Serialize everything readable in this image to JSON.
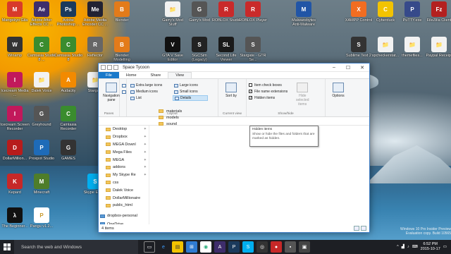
{
  "desktop_icons": [
    {
      "label": "Mangekyo Gila",
      "color": "#d83a2a",
      "glyph": "M"
    },
    {
      "label": "Adobe After Effects CC ...",
      "color": "#3e2d6b",
      "glyph": "Ae"
    },
    {
      "label": "Adobe Photoshop ...",
      "color": "#1b3a5c",
      "glyph": "Ps"
    },
    {
      "label": "Adobe Media Encoder CC ...",
      "color": "#222233",
      "glyph": "Me"
    },
    {
      "label": "Blender",
      "color": "#e37b1a",
      "glyph": "B"
    },
    {
      "label": "Garry's Mod Stuff",
      "color": "#f2f2f2",
      "glyph": "📁"
    },
    {
      "label": "Garry's Mod",
      "color": "#555",
      "glyph": "G"
    },
    {
      "label": "ROBLOX Studio",
      "color": "#c92a2a",
      "glyph": "R"
    },
    {
      "label": "ROBLOX Player",
      "color": "#c92a2a",
      "glyph": "R"
    },
    {
      "label": "Malwarebytes Anti-Malware",
      "color": "#2155a6",
      "glyph": "M"
    },
    {
      "label": "XAMPP Control",
      "color": "#f26d21",
      "glyph": "X"
    },
    {
      "label": "Cyberduck",
      "color": "#f2c300",
      "glyph": "C"
    },
    {
      "label": "PuTTY.exe",
      "color": "#364a8a",
      "glyph": "P"
    },
    {
      "label": "FileZilla Client",
      "color": "#b3201f",
      "glyph": "Fz"
    },
    {
      "label": "Winamp",
      "color": "#333",
      "glyph": "W"
    },
    {
      "label": "Camtasia Studio 8 ...",
      "color": "#3a8c2e",
      "glyph": "C"
    },
    {
      "label": "Camtasia Studio 8",
      "color": "#3a8c2e",
      "glyph": "C"
    },
    {
      "label": "Reflector",
      "color": "#666",
      "glyph": "R"
    },
    {
      "label": "Blender Modelling",
      "color": "#e37b1a",
      "glyph": "B"
    },
    {
      "label": "GTA V Save Editor",
      "color": "#111",
      "glyph": "V"
    },
    {
      "label": "SGCSim (Legacy)",
      "color": "#222",
      "glyph": "S"
    },
    {
      "label": "Second Life Viewer",
      "color": "#1a1a1a",
      "glyph": "SL"
    },
    {
      "label": "Stargate - GTR Se...",
      "color": "#555",
      "glyph": "S"
    },
    {
      "label": "Sublime Text 2",
      "color": "#333",
      "glyph": "S"
    },
    {
      "label": "spcheckerstat...",
      "color": "#f2f2f2",
      "glyph": "📁"
    },
    {
      "label": "themefiles...",
      "color": "#f2f2f2",
      "glyph": "📁"
    },
    {
      "label": "Paypal Receipt",
      "color": "#f2f2f2",
      "glyph": "📁"
    },
    {
      "label": "Icecream Media ...",
      "color": "#c2185b",
      "glyph": "I"
    },
    {
      "label": "Dalek Voice",
      "color": "#f2f2f2",
      "glyph": "📁"
    },
    {
      "label": "Audacity",
      "color": "#f28a00",
      "glyph": "A"
    },
    {
      "label": "Stargate",
      "color": "#f2f2f2",
      "glyph": "📁"
    },
    {
      "label": "Icecream Screen Recorder",
      "color": "#c2185b",
      "glyph": "I"
    },
    {
      "label": "Greyhound",
      "color": "#555",
      "glyph": "G"
    },
    {
      "label": "Camtasia Recorder",
      "color": "#3a8c2e",
      "glyph": "C"
    },
    {
      "label": "DollarMillion...",
      "color": "#b71c1c",
      "glyph": "D"
    },
    {
      "label": "Proxpot Studio",
      "color": "#1e6bb8",
      "glyph": "P"
    },
    {
      "label": "GAMES",
      "color": "#333",
      "glyph": "G"
    },
    {
      "label": "Kepard",
      "color": "#c62828",
      "glyph": "K"
    },
    {
      "label": "Minecraft",
      "color": "#4e7d2a",
      "glyph": "M"
    },
    {
      "label": "Skype Export",
      "color": "#00aff0",
      "glyph": "S"
    },
    {
      "label": "The Beginner...",
      "color": "#111",
      "glyph": "λ"
    },
    {
      "label": "Pangu v1.2...",
      "color": "#fff",
      "glyph": "P"
    }
  ],
  "window": {
    "title": "Space Tycoon",
    "tabs": [
      "File",
      "Home",
      "Share",
      "View"
    ],
    "ribbon": {
      "navigation_pane": "Navigation pane",
      "panes_label": "Panes",
      "layout_options": [
        "Extra large icons",
        "Large icons",
        "Medium icons",
        "Small icons",
        "List",
        "Details"
      ],
      "layout_label": "Layout",
      "sort_by": "Sort by",
      "current_view_label": "Current view",
      "checkboxes": [
        {
          "label": "Item check boxes",
          "checked": false
        },
        {
          "label": "File name extensions",
          "checked": true
        },
        {
          "label": "Hidden items",
          "checked": true
        }
      ],
      "hide_selected": "Hide selected items",
      "show_hide_label": "Show/hide",
      "options": "Options"
    },
    "tooltip": {
      "title": "Hidden items",
      "body": "Show or hide the files and folders that are marked as hidden."
    },
    "nav_items": [
      {
        "label": "Desktop",
        "pinned": true,
        "top": false
      },
      {
        "label": "Dropbox",
        "pinned": true,
        "top": false
      },
      {
        "label": "MEGA Downl",
        "pinned": true,
        "top": false
      },
      {
        "label": "Mega Files",
        "pinned": true,
        "top": false
      },
      {
        "label": "MEGA",
        "pinned": true,
        "top": false
      },
      {
        "label": "addons",
        "pinned": true,
        "top": false
      },
      {
        "label": "My Skype Re",
        "pinned": true,
        "top": false
      },
      {
        "label": "css",
        "pinned": false,
        "top": false
      },
      {
        "label": "Dalek Voice",
        "pinned": false,
        "top": false
      },
      {
        "label": "DollarMillionaire",
        "pinned": false,
        "top": false
      },
      {
        "label": "public_html",
        "pinned": false,
        "top": false
      },
      {
        "label": "dropbox-personal",
        "pinned": false,
        "top": true
      },
      {
        "label": "OneDrive",
        "pinned": false,
        "top": true
      },
      {
        "label": "This PC",
        "pinned": false,
        "top": true
      }
    ],
    "files": [
      "materials",
      "models",
      "sound"
    ],
    "status": "4 items"
  },
  "taskbar": {
    "search_placeholder": "Search the web and Windows",
    "time": "6:52 PM",
    "date": "2015-10-17"
  },
  "watermark": {
    "line1": "Windows 10 Pro Insider Preview",
    "line2": "Evaluation copy. Build 10565"
  }
}
